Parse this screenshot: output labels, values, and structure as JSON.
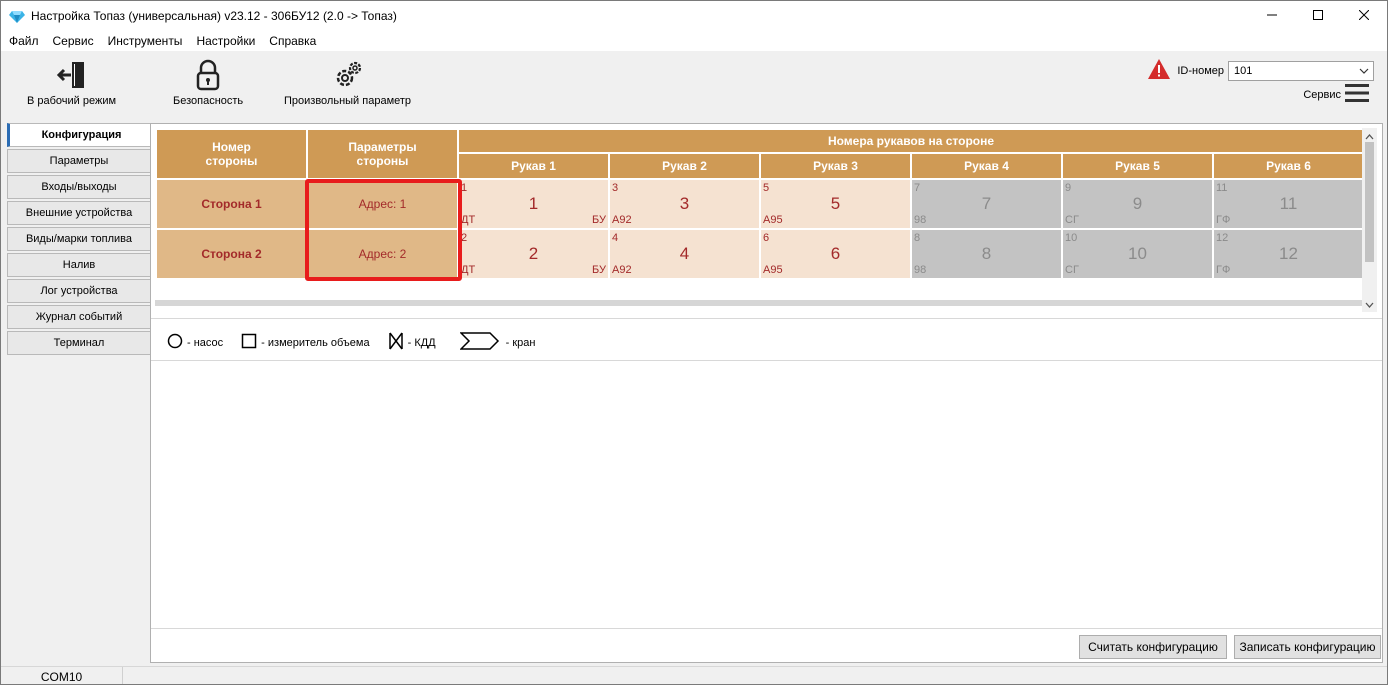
{
  "window": {
    "title": "Настройка Топаз (универсальная) v23.12 - 306БУ12 (2.0 -> Топаз)"
  },
  "menu": [
    "Файл",
    "Сервис",
    "Инструменты",
    "Настройки",
    "Справка"
  ],
  "toolbar": {
    "work_mode": "В рабочий режим",
    "security": "Безопасность",
    "custom_param": "Произвольный параметр",
    "id_label": "ID-номер",
    "id_value": "101",
    "service_label": "Сервис"
  },
  "nav": [
    "Конфигурация",
    "Параметры",
    "Входы/выходы",
    "Внешние устройства",
    "Виды/марки топлива",
    "Налив",
    "Лог устройства",
    "Журнал событий",
    "Терминал"
  ],
  "grid": {
    "col_side_number": "Номер стороны",
    "col_side_params": "Параметры стороны",
    "hoses_group": "Номера рукавов на стороне",
    "hose_headers": [
      "Рукав 1",
      "Рукав 2",
      "Рукав 3",
      "Рукав 4",
      "Рукав 5",
      "Рукав 6"
    ],
    "rows": [
      {
        "name": "Сторона 1",
        "param": "Адрес: 1",
        "hoses": [
          {
            "small": "1",
            "big": "1",
            "left": "ДТ",
            "right": "БУ",
            "active": true
          },
          {
            "small": "3",
            "big": "3",
            "left": "А92",
            "right": "",
            "active": true
          },
          {
            "small": "5",
            "big": "5",
            "left": "А95",
            "right": "",
            "active": true
          },
          {
            "small": "7",
            "big": "7",
            "left": "98",
            "right": "",
            "active": false
          },
          {
            "small": "9",
            "big": "9",
            "left": "СГ",
            "right": "",
            "active": false
          },
          {
            "small": "11",
            "big": "11",
            "left": "ГФ",
            "right": "",
            "active": false
          }
        ]
      },
      {
        "name": "Сторона 2",
        "param": "Адрес: 2",
        "hoses": [
          {
            "small": "2",
            "big": "2",
            "left": "ДТ",
            "right": "БУ",
            "active": true
          },
          {
            "small": "4",
            "big": "4",
            "left": "А92",
            "right": "",
            "active": true
          },
          {
            "small": "6",
            "big": "6",
            "left": "А95",
            "right": "",
            "active": true
          },
          {
            "small": "8",
            "big": "8",
            "left": "98",
            "right": "",
            "active": false
          },
          {
            "small": "10",
            "big": "10",
            "left": "СГ",
            "right": "",
            "active": false
          },
          {
            "small": "12",
            "big": "12",
            "left": "ГФ",
            "right": "",
            "active": false
          }
        ]
      }
    ]
  },
  "legend": {
    "pump": "- насос",
    "meter": "- измеритель объема",
    "valve": "- КДД",
    "tap": "- кран"
  },
  "buttons": {
    "read": "Считать конфигурацию",
    "write": "Записать конфигурацию"
  },
  "status": {
    "port": "COM10"
  },
  "colors": {
    "header": "#cf9a55",
    "side_cell": "#e0b887",
    "active_hose": "#f5e2d1",
    "inactive_hose": "#c3c3c3",
    "accent_text": "#a32a2a",
    "highlight": "#e81c1c"
  },
  "icons": [
    "diamond-app-icon",
    "exit-door-icon",
    "padlock-icon",
    "gears-icon",
    "warning-icon",
    "hamburger-icon",
    "chevron-down-icon",
    "minimize-icon",
    "maximize-icon",
    "close-icon"
  ]
}
